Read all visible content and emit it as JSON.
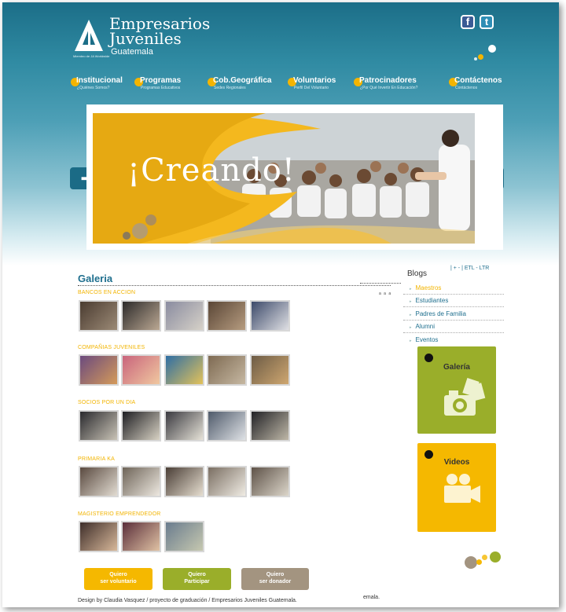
{
  "brand": {
    "line1": "Empresarios",
    "line2": "Juveniles",
    "line3": "Guatemala",
    "tagline": "Miembro de JA Worldwide"
  },
  "social": [
    {
      "label": "f",
      "icon": "facebook-icon"
    },
    {
      "label": "t",
      "icon": "twitter-icon"
    }
  ],
  "nav": [
    {
      "title": "Institucional",
      "sub": "¿Quiénes Somos?"
    },
    {
      "title": "Programas",
      "sub": "Programas Educativos"
    },
    {
      "title": "Cob.Geográfica",
      "sub": "Sedes Regionales"
    },
    {
      "title": "Voluntarios",
      "sub": "Perfil Del Voluntario"
    },
    {
      "title": "Patrocinadores",
      "sub": "¿Por Qué Invertir En Educación?"
    },
    {
      "title": "Contáctenos",
      "sub": "Contáctenos"
    }
  ],
  "banner": {
    "title": "¡Creando!",
    "prev_arrow": "➡",
    "next_arrow": "⬅"
  },
  "gallery": {
    "title": "Galeria",
    "tools": "a a a",
    "categories": [
      {
        "name": "BANCOS EN ACCION",
        "count": 5
      },
      {
        "name": "COMPAÑIAS JUVENILES",
        "count": 5
      },
      {
        "name": "SOCIOS POR UN DIA",
        "count": 5
      },
      {
        "name": "PRIMARIA KA",
        "count": 5
      },
      {
        "name": "MAGISTERIO EMPRENDEDOR",
        "count": 3
      }
    ]
  },
  "blogs": {
    "title": "Blogs",
    "font_controls": "| + - | ETL - LTR",
    "items": [
      "Maestros",
      "Estudiantes",
      "Padres de Familia",
      "Alumni",
      "Eventos"
    ],
    "selected": "Maestros"
  },
  "panels": {
    "gallery": "Galería",
    "videos": "Videos"
  },
  "buttons": [
    {
      "line1": "Quiero",
      "line2": "ser voluntario",
      "color": "#f5b800"
    },
    {
      "line1": "Quiero",
      "line2": "Participar",
      "color": "#9aae2a"
    },
    {
      "line1": "Quiero",
      "line2": "ser donador",
      "color": "#a39480"
    }
  ],
  "footer": {
    "credit": "Design by Claudia Vasquez / proyecto de graduación / Empresarios Juveniles Guatemala.",
    "extra": "emala."
  },
  "colors": {
    "accent_yellow": "#f5b800",
    "accent_green": "#9aae2a",
    "teal": "#1f6f8e"
  }
}
